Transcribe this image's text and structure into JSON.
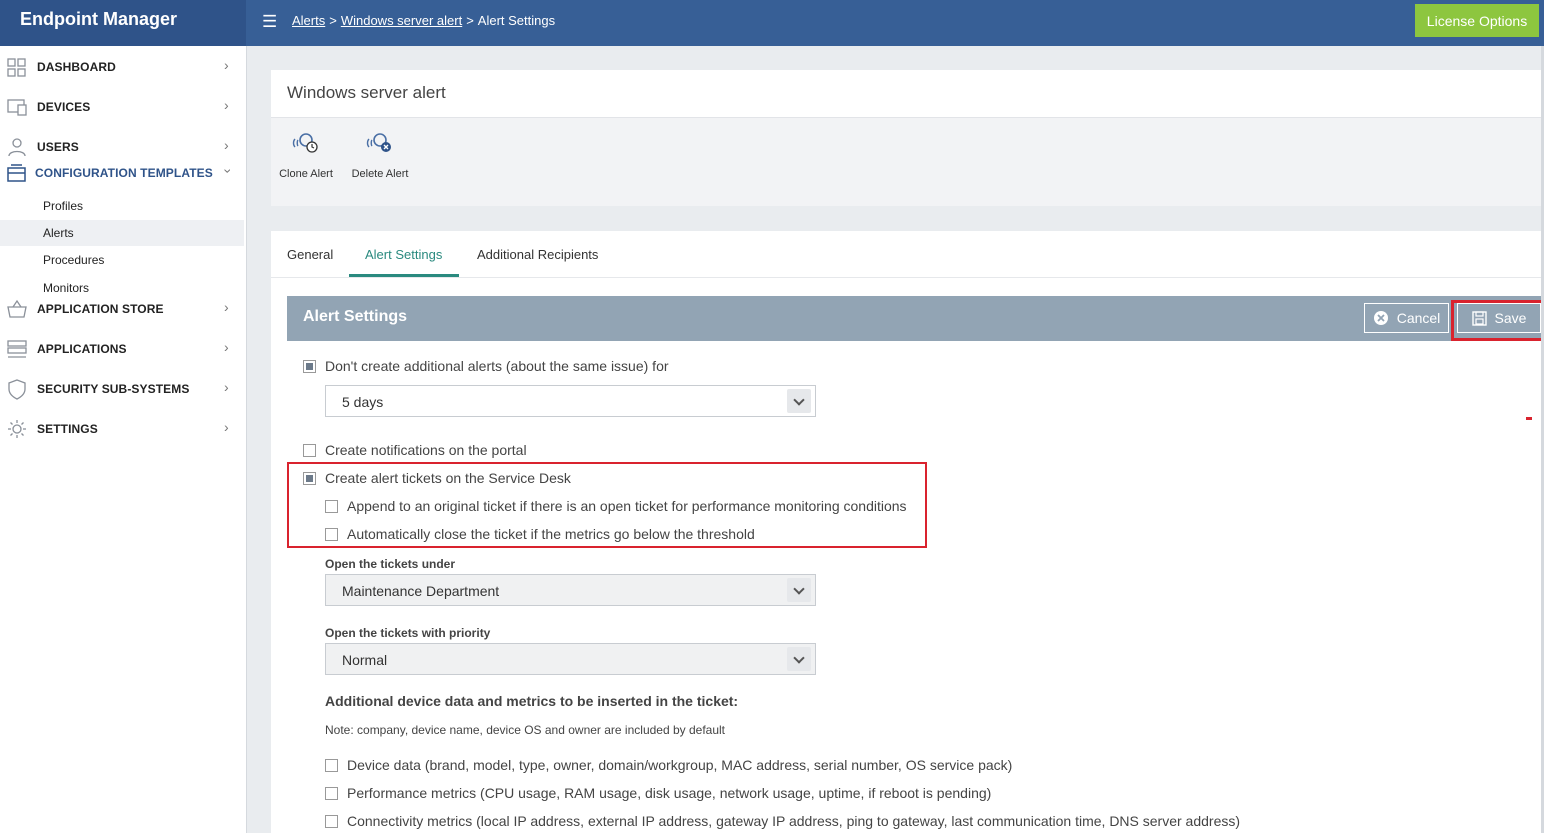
{
  "app": {
    "title": "Endpoint Manager"
  },
  "breadcrumb": {
    "items": [
      "Alerts",
      "Windows server alert",
      "Alert Settings"
    ],
    "separator": ">"
  },
  "license_button": "License Options",
  "sidebar": {
    "items": [
      {
        "label": "DASHBOARD",
        "icon": "dashboard-icon"
      },
      {
        "label": "DEVICES",
        "icon": "devices-icon"
      },
      {
        "label": "USERS",
        "icon": "users-icon"
      },
      {
        "label": "CONFIGURATION TEMPLATES",
        "icon": "configuration-templates-icon",
        "expanded": true,
        "children": [
          "Profiles",
          "Alerts",
          "Procedures",
          "Monitors"
        ],
        "active_child": "Alerts"
      },
      {
        "label": "APPLICATION STORE",
        "icon": "application-store-icon"
      },
      {
        "label": "APPLICATIONS",
        "icon": "applications-icon"
      },
      {
        "label": "SECURITY SUB-SYSTEMS",
        "icon": "security-shield-icon"
      },
      {
        "label": "SETTINGS",
        "icon": "settings-gear-icon"
      }
    ]
  },
  "header": {
    "title": "Windows server alert"
  },
  "toolbar": {
    "clone_label": "Clone Alert",
    "delete_label": "Delete Alert"
  },
  "tabs": [
    {
      "label": "General",
      "active": false
    },
    {
      "label": "Alert Settings",
      "active": true
    },
    {
      "label": "Additional Recipients",
      "active": false
    }
  ],
  "panel": {
    "title": "Alert Settings",
    "cancel_label": "Cancel",
    "save_label": "Save"
  },
  "settings": {
    "no_additional_alerts": {
      "label": "Don't create additional alerts (about the same issue) for",
      "checked": true
    },
    "duration_select": {
      "value": "5 days"
    },
    "portal_notifications": {
      "label": "Create notifications on the portal",
      "checked": false
    },
    "service_desk_tickets": {
      "label": "Create alert tickets on the Service Desk",
      "checked": true
    },
    "append_ticket": {
      "label": "Append to an original ticket if there is an open ticket for performance monitoring conditions",
      "checked": false
    },
    "auto_close": {
      "label": "Automatically close the ticket if the metrics go below the threshold",
      "checked": false
    },
    "tickets_under": {
      "label": "Open the tickets under",
      "value": "Maintenance Department"
    },
    "tickets_priority": {
      "label": "Open the tickets with priority",
      "value": "Normal"
    },
    "additional_heading": "Additional device data and metrics to be inserted in the ticket:",
    "note": "Note: company, device name, device OS and owner are included by default",
    "device_data": {
      "label": "Device data (brand, model, type, owner, domain/workgroup, MAC address, serial number, OS service pack)",
      "checked": false
    },
    "performance_metrics": {
      "label": "Performance metrics (CPU usage, RAM usage, disk usage, network usage, uptime, if reboot is pending)",
      "checked": false
    },
    "connectivity_metrics": {
      "label": "Connectivity metrics (local IP address, external IP address, gateway IP address, ping to gateway, last communication time, DNS server address)",
      "checked": false
    }
  },
  "colors": {
    "topbar": "#375f96",
    "brand_bg": "#2f5389",
    "license_green": "#8dc63f",
    "accent_teal": "#2a8a7f",
    "panel_bar": "#92a4b4",
    "highlight_red": "#d9232e"
  }
}
